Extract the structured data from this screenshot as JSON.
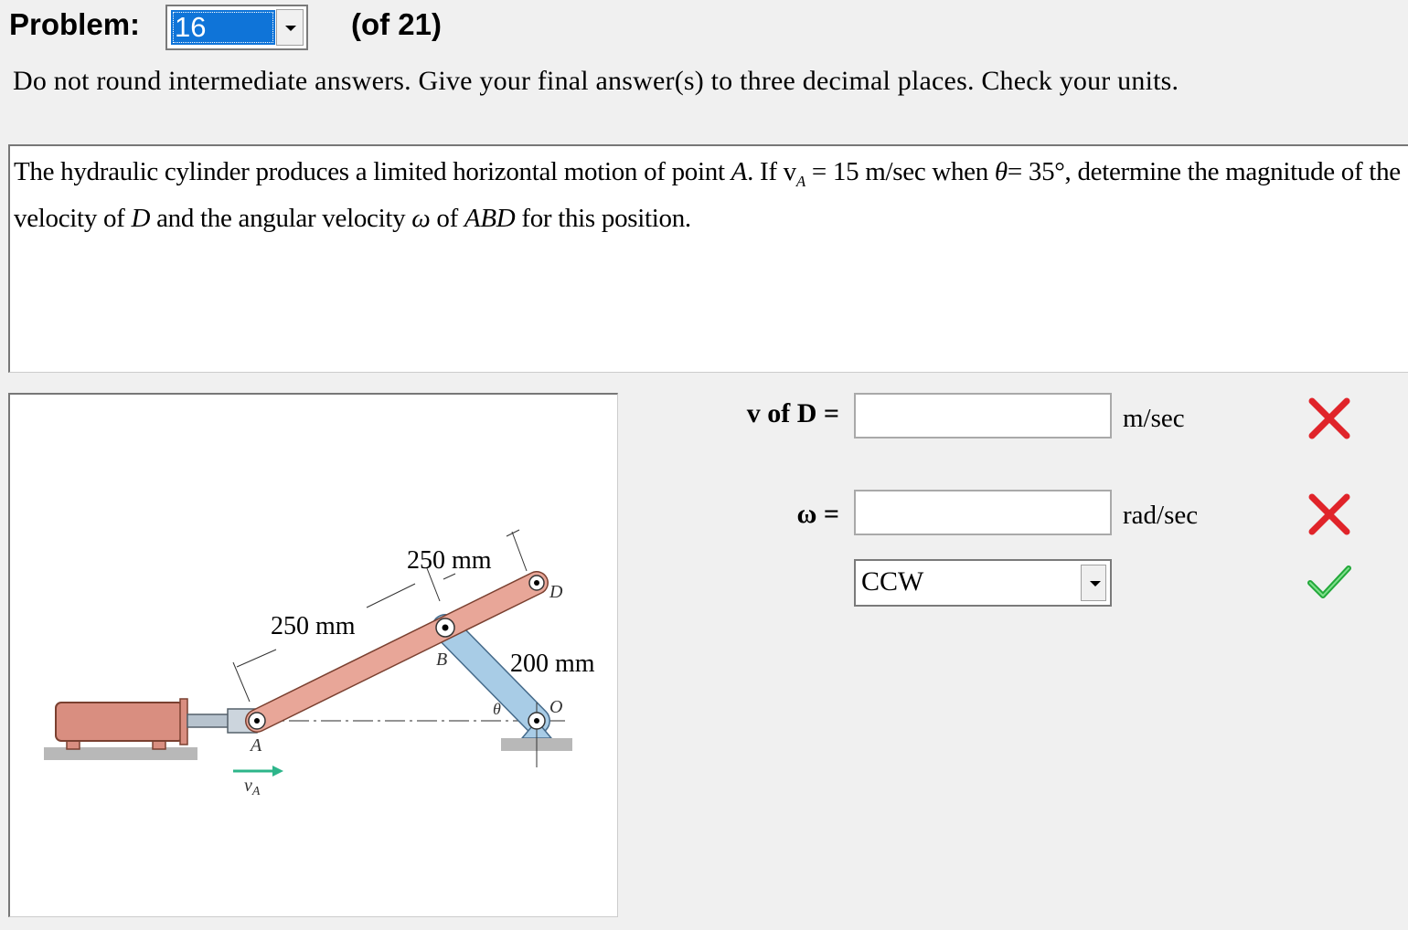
{
  "header": {
    "problem_label": "Problem:",
    "problem_number": "16",
    "of_label": "(of 21)"
  },
  "instructions": "Do not round intermediate answers.  Give your final answer(s) to three decimal places.  Check your units.",
  "question": {
    "s1": "The hydraulic cylinder produces a limited horizontal motion of point ",
    "A": "A",
    "s2": ". If v",
    "sub_A": "A",
    "s3": " = 15 m/sec when ",
    "theta": "θ",
    "s4": "= 35°, determine the magnitude of the velocity of ",
    "D": "D",
    "s5": " and the angular velocity ",
    "omega": "ω",
    "s6": " of ",
    "ABD": "ABD",
    "s7": " for this position."
  },
  "figure": {
    "dim_250_upper": "250 mm",
    "dim_250_lower": "250 mm",
    "dim_200": "200 mm",
    "label_A": "A",
    "label_B": "B",
    "label_D": "D",
    "label_O": "O",
    "label_theta": "θ",
    "label_vA_v": "v",
    "label_vA_sub": "A",
    "colors": {
      "link_abd": "#e8a698",
      "link_bo": "#a8cce6",
      "cylinder": "#d98e80",
      "ground": "#b8b8b8",
      "arrow": "#2db58a"
    }
  },
  "answers": {
    "vD": {
      "label": "v of D =",
      "value": "",
      "unit": "m/sec",
      "status": "incorrect",
      "status_icon": "red-x-icon"
    },
    "omega": {
      "label": "ω =",
      "value": "",
      "unit": "rad/sec",
      "status": "incorrect",
      "status_icon": "red-x-icon"
    },
    "direction": {
      "selected": "CCW",
      "status": "correct",
      "status_icon": "green-check-icon"
    }
  }
}
